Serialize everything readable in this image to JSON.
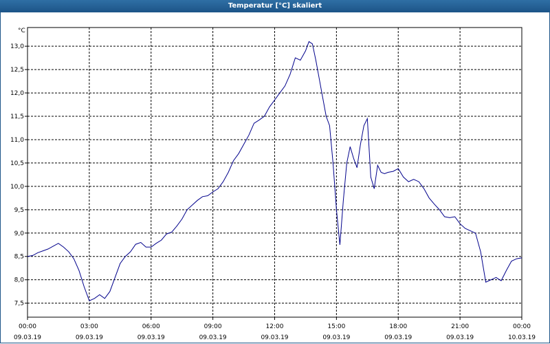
{
  "window": {
    "title": "Temperatur [°C] skaliert"
  },
  "chart_data": {
    "type": "line",
    "title": "Temperatur [°C] skaliert",
    "ylabel": "°C",
    "xlabel": "",
    "ylim": [
      7.2,
      13.4
    ],
    "grid": true,
    "line_color": "#00008b",
    "x_ticks": [
      {
        "time": "00:00",
        "date": "09.03.19"
      },
      {
        "time": "03:00",
        "date": "09.03.19"
      },
      {
        "time": "06:00",
        "date": "09.03.19"
      },
      {
        "time": "09:00",
        "date": "09.03.19"
      },
      {
        "time": "12:00",
        "date": "09.03.19"
      },
      {
        "time": "15:00",
        "date": "09.03.19"
      },
      {
        "time": "18:00",
        "date": "09.03.19"
      },
      {
        "time": "21:00",
        "date": "09.03.19"
      },
      {
        "time": "00:00",
        "date": "10.03.19"
      }
    ],
    "y_ticks": [
      "7,5",
      "8,0",
      "8,5",
      "9,0",
      "9,5",
      "10,0",
      "10,5",
      "11,0",
      "11,5",
      "12,0",
      "12,5",
      "13,0"
    ],
    "series": [
      {
        "x": [
          "09.03.19 00:00",
          "09.03.19 00:15",
          "09.03.19 00:30",
          "09.03.19 00:45",
          "09.03.19 01:00",
          "09.03.19 01:15",
          "09.03.19 01:30",
          "09.03.19 01:45",
          "09.03.19 02:00",
          "09.03.19 02:15",
          "09.03.19 02:30",
          "09.03.19 02:45",
          "09.03.19 03:00",
          "09.03.19 03:15",
          "09.03.19 03:30",
          "09.03.19 03:45",
          "09.03.19 04:00",
          "09.03.19 04:15",
          "09.03.19 04:30",
          "09.03.19 04:45",
          "09.03.19 05:00",
          "09.03.19 05:15",
          "09.03.19 05:30",
          "09.03.19 05:45",
          "09.03.19 06:00",
          "09.03.19 06:15",
          "09.03.19 06:30",
          "09.03.19 06:45",
          "09.03.19 07:00",
          "09.03.19 07:15",
          "09.03.19 07:30",
          "09.03.19 07:45",
          "09.03.19 08:00",
          "09.03.19 08:15",
          "09.03.19 08:30",
          "09.03.19 08:45",
          "09.03.19 09:00",
          "09.03.19 09:15",
          "09.03.19 09:30",
          "09.03.19 09:45",
          "09.03.19 10:00",
          "09.03.19 10:15",
          "09.03.19 10:30",
          "09.03.19 10:45",
          "09.03.19 11:00",
          "09.03.19 11:15",
          "09.03.19 11:30",
          "09.03.19 11:45",
          "09.03.19 12:00",
          "09.03.19 12:15",
          "09.03.19 12:30",
          "09.03.19 12:45",
          "09.03.19 13:00",
          "09.03.19 13:15",
          "09.03.19 13:30",
          "09.03.19 13:40",
          "09.03.19 13:50",
          "09.03.19 14:00",
          "09.03.19 14:10",
          "09.03.19 14:20",
          "09.03.19 14:30",
          "09.03.19 14:40",
          "09.03.19 14:50",
          "09.03.19 15:00",
          "09.03.19 15:10",
          "09.03.19 15:20",
          "09.03.19 15:30",
          "09.03.19 15:40",
          "09.03.19 15:50",
          "09.03.19 16:00",
          "09.03.19 16:10",
          "09.03.19 16:20",
          "09.03.19 16:30",
          "09.03.19 16:40",
          "09.03.19 16:50",
          "09.03.19 17:00",
          "09.03.19 17:10",
          "09.03.19 17:20",
          "09.03.19 17:30",
          "09.03.19 17:45",
          "09.03.19 18:00",
          "09.03.19 18:15",
          "09.03.19 18:30",
          "09.03.19 18:45",
          "09.03.19 19:00",
          "09.03.19 19:15",
          "09.03.19 19:30",
          "09.03.19 19:45",
          "09.03.19 20:00",
          "09.03.19 20:15",
          "09.03.19 20:30",
          "09.03.19 20:45",
          "09.03.19 21:00",
          "09.03.19 21:15",
          "09.03.19 21:30",
          "09.03.19 21:45",
          "09.03.19 22:00",
          "09.03.19 22:15",
          "09.03.19 22:30",
          "09.03.19 22:45",
          "09.03.19 23:00",
          "09.03.19 23:15",
          "09.03.19 23:30",
          "09.03.19 23:45",
          "10.03.19 00:00"
        ],
        "values": [
          8.5,
          8.52,
          8.58,
          8.62,
          8.66,
          8.72,
          8.78,
          8.7,
          8.6,
          8.45,
          8.2,
          7.85,
          7.55,
          7.6,
          7.68,
          7.6,
          7.75,
          8.05,
          8.35,
          8.5,
          8.6,
          8.76,
          8.8,
          8.7,
          8.7,
          8.78,
          8.85,
          8.98,
          9.02,
          9.15,
          9.3,
          9.5,
          9.6,
          9.7,
          9.78,
          9.8,
          9.88,
          9.95,
          10.1,
          10.3,
          10.55,
          10.7,
          10.9,
          11.1,
          11.35,
          11.42,
          11.5,
          11.7,
          11.85,
          12.0,
          12.15,
          12.4,
          12.75,
          12.7,
          12.9,
          13.1,
          13.05,
          12.7,
          12.3,
          11.9,
          11.5,
          11.3,
          10.5,
          9.5,
          8.75,
          9.7,
          10.5,
          10.85,
          10.6,
          10.4,
          10.9,
          11.3,
          11.45,
          10.2,
          9.95,
          10.45,
          10.3,
          10.27,
          10.3,
          10.32,
          10.38,
          10.2,
          10.1,
          10.15,
          10.1,
          9.95,
          9.75,
          9.62,
          9.5,
          9.35,
          9.33,
          9.35,
          9.2,
          9.1,
          9.05,
          9.0,
          8.6,
          7.95,
          8.0,
          8.05,
          7.98,
          8.2,
          8.4,
          8.45,
          8.47
        ]
      }
    ]
  }
}
